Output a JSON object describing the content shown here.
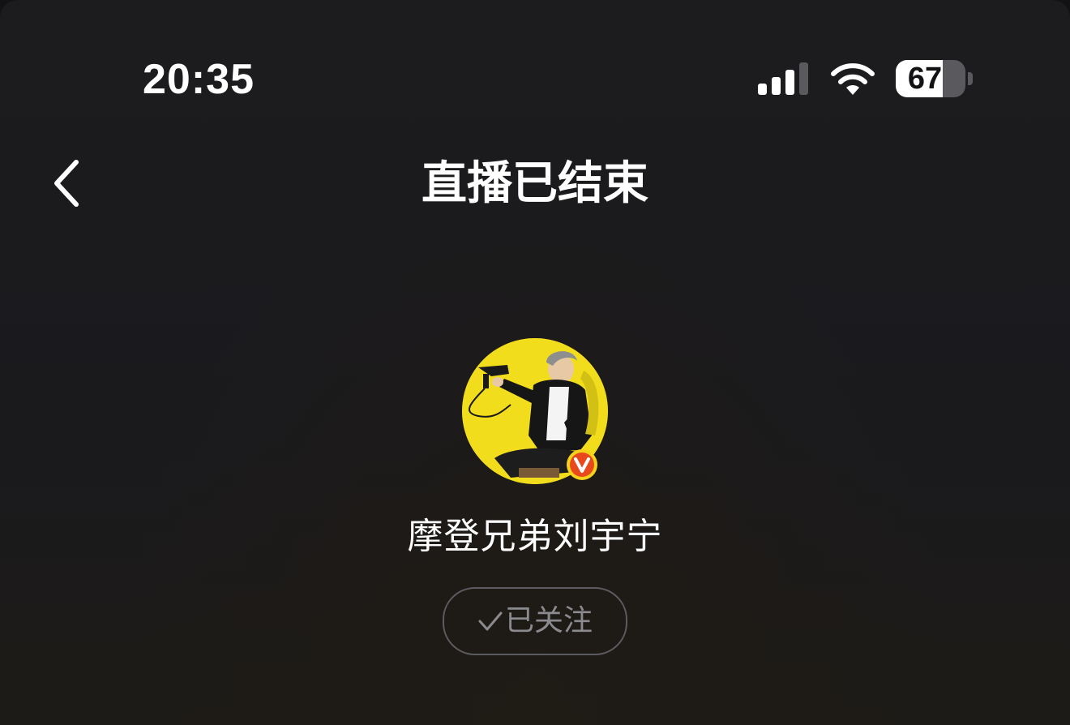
{
  "status_bar": {
    "time": "20:35",
    "battery_level": "67",
    "battery_fraction": 0.67,
    "icons": [
      "signal-icon",
      "wifi-icon",
      "battery-icon"
    ]
  },
  "nav": {
    "back_icon": "chevron-left-icon",
    "title": "直播已结束"
  },
  "profile": {
    "avatar_bg_color": "#f2dd1c",
    "verified_badge_letter": "V",
    "verified_badge_color": "#e8481b",
    "name": "摩登兄弟刘宇宁"
  },
  "follow_button": {
    "icon": "check-icon",
    "label": "已关注"
  },
  "colors": {
    "background": "#1b1b1e",
    "text": "#ffffff",
    "muted": "#8b8b8f"
  }
}
